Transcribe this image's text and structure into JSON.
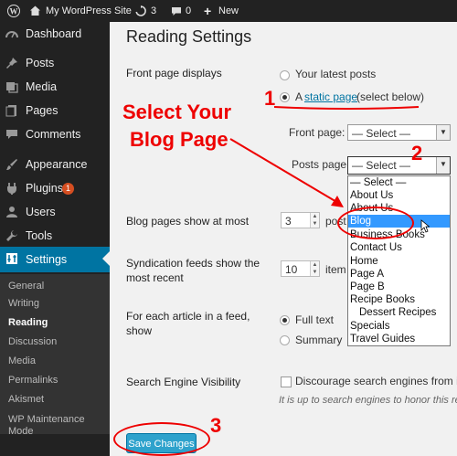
{
  "adminbar": {
    "site_name": "My WordPress Site",
    "updates_count": "3",
    "comments_count": "0",
    "new_label": "New"
  },
  "sidebar": {
    "items": [
      {
        "label": "Dashboard"
      },
      {
        "label": "Posts"
      },
      {
        "label": "Media"
      },
      {
        "label": "Pages"
      },
      {
        "label": "Comments"
      },
      {
        "label": "Appearance"
      },
      {
        "label": "Plugins",
        "badge": "1"
      },
      {
        "label": "Users"
      },
      {
        "label": "Tools"
      },
      {
        "label": "Settings"
      }
    ],
    "submenu": [
      "General",
      "Writing",
      "Reading",
      "Discussion",
      "Media",
      "Permalinks",
      "Akismet",
      "WP Maintenance",
      "Mode"
    ]
  },
  "page": {
    "title": "Reading Settings",
    "front_page_displays_label": "Front page displays",
    "opt_latest_posts": "Your latest posts",
    "opt_static_prefix": "A",
    "opt_static_link": "static page",
    "opt_static_suffix": "(select below)",
    "front_page_label": "Front page:",
    "front_page_value": "— Select —",
    "posts_page_label": "Posts page:",
    "posts_page_value": "— Select —",
    "dropdown_options": [
      "— Select —",
      "About Us",
      "About Us",
      "Blog",
      "Business Books",
      "Contact Us",
      "Home",
      "Page A",
      "Page B",
      "Recipe Books",
      "Dessert Recipes",
      "Specials",
      "Travel Guides"
    ],
    "blog_show_label": "Blog pages show at most",
    "blog_show_value": "3",
    "blog_show_unit": "post",
    "synd_label_1": "Syndication feeds show the",
    "synd_label_2": "most recent",
    "synd_value": "10",
    "synd_unit": "item",
    "feed_label_1": "For each article in a feed,",
    "feed_label_2": "show",
    "feed_full": "Full text",
    "feed_summary": "Summary",
    "sev_label": "Search Engine Visibility",
    "sev_checkbox": "Discourage search engines from in",
    "sev_desc": "It is up to search engines to honor this re",
    "save_button": "Save Changes"
  },
  "annotations": {
    "callout_line1": "Select Your",
    "callout_line2": "Blog Page",
    "step1": "1",
    "step2": "2",
    "step3": "3",
    "color": "#e00000"
  }
}
